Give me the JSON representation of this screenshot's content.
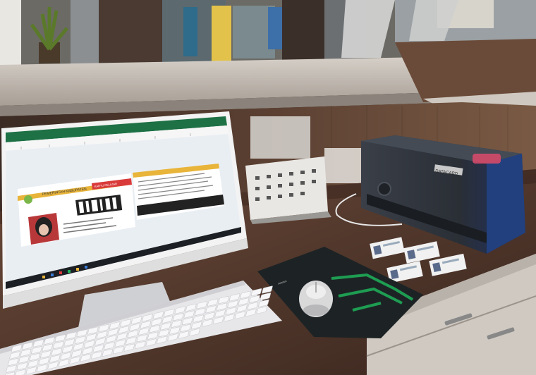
{
  "scene": {
    "description_visible_text": {
      "screen_card_header": "PEMERINTAH KABUPATEN",
      "screen_card_badge": "KARTU PELAJAR",
      "printer_brand": "DATACARD"
    }
  },
  "colors": {
    "wall": "#7a5a44",
    "counter_top": "#bdb4aa",
    "desk_wood": "#4a3328",
    "monitor_frame": "#f2f2f2",
    "screen_bg": "#e9eef3",
    "excel_green": "#1e7145",
    "card_yellow": "#e8b43a",
    "card_red": "#d93a3a",
    "printer_body": "#2b2f36",
    "printer_blue": "#2a4a8a",
    "mousepad": "#1d2325",
    "mousepad_green": "#1fb35a",
    "keyboard": "#e7e7ea"
  },
  "icons": {
    "mouse": "mouse-icon",
    "printer": "printer-icon",
    "monitor": "monitor-icon",
    "keyboard": "keyboard-icon"
  }
}
